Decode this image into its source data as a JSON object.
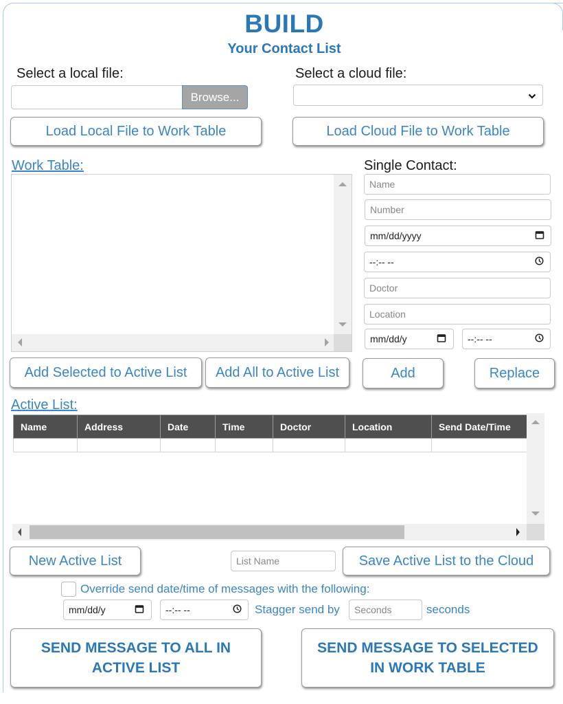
{
  "header": {
    "title": "BUILD",
    "subtitle": "Your Contact List"
  },
  "local_file": {
    "label": "Select a local file:",
    "value": "",
    "browse_label": "Browse...",
    "load_button": "Load Local File to Work Table"
  },
  "cloud_file": {
    "label": "Select a cloud file:",
    "selected": "",
    "load_button": "Load Cloud File to Work Table"
  },
  "work_table": {
    "label": "Work Table:",
    "rows": [],
    "add_selected_button": "Add Selected to Active List",
    "add_all_button": "Add All to Active List"
  },
  "single_contact": {
    "label": "Single Contact:",
    "name_placeholder": "Name",
    "number_placeholder": "Number",
    "date_placeholder": "mm/dd/yyyy",
    "time_placeholder": "--:-- --",
    "doctor_placeholder": "Doctor",
    "location_placeholder": "Location",
    "send_date_placeholder": "mm/dd/y",
    "send_time_placeholder": "--:-- --",
    "add_button": "Add",
    "replace_button": "Replace"
  },
  "active_list": {
    "label": "Active List:",
    "columns": [
      "Name",
      "Address",
      "Date",
      "Time",
      "Doctor",
      "Location",
      "Send Date/Time"
    ],
    "rows": [
      [
        "",
        "",
        "",
        "",
        "",
        "",
        ""
      ]
    ],
    "horizontal_scroll_fraction": 0.78,
    "new_button": "New Active List",
    "list_name_placeholder": "List Name",
    "save_button": "Save Active List to the Cloud"
  },
  "override": {
    "checked": false,
    "label": "Override send date/time of messages with the following:",
    "date_placeholder": "mm/dd/y",
    "time_placeholder": "--:-- --",
    "stagger_label": "Stagger send by",
    "seconds_placeholder": "Seconds",
    "seconds_suffix": "seconds"
  },
  "actions": {
    "send_all_button": "SEND MESSAGE TO ALL IN ACTIVE LIST",
    "send_selected_button": "SEND MESSAGE TO SELECTED IN WORK TABLE"
  },
  "colors": {
    "accent": "#2b78b8",
    "link": "#3a86c6",
    "table_header": "#4f4f4f",
    "browse_bg": "#a5a5a5"
  }
}
